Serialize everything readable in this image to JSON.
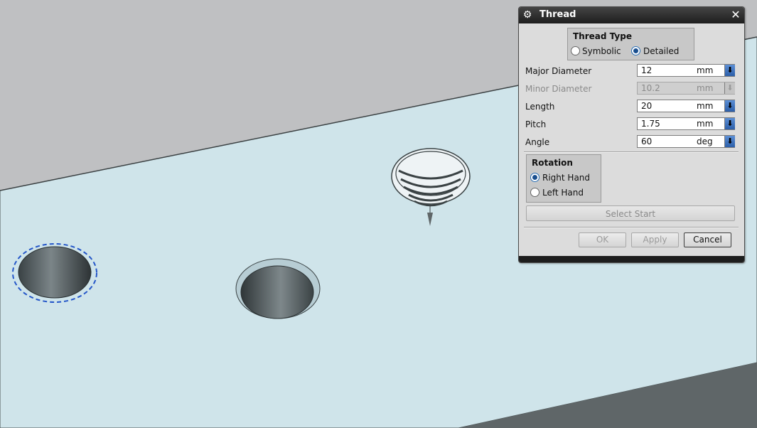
{
  "dialog": {
    "title": "Thread",
    "settings_icon": "gear-icon",
    "close_icon": "close-icon",
    "thread_type": {
      "title": "Thread Type",
      "options": [
        "Symbolic",
        "Detailed"
      ],
      "selected": "Detailed"
    },
    "rows": [
      {
        "label": "Major Diameter",
        "value": "12",
        "unit": "mm",
        "enabled": true
      },
      {
        "label": "Minor Diameter",
        "value": "10.2",
        "unit": "mm",
        "enabled": false
      },
      {
        "label": "Length",
        "value": "20",
        "unit": "mm",
        "enabled": true
      },
      {
        "label": "Pitch",
        "value": "1.75",
        "unit": "mm",
        "enabled": true
      },
      {
        "label": "Angle",
        "value": "60",
        "unit": "deg",
        "enabled": true
      }
    ],
    "rotation": {
      "title": "Rotation",
      "options": [
        "Right Hand",
        "Left Hand"
      ],
      "selected": "Right Hand"
    },
    "select_start": "Select Start",
    "ok": "OK",
    "apply": "Apply",
    "cancel": "Cancel"
  },
  "colors": {
    "face": "#cfe4ea",
    "wall": "#bfc0c2",
    "dark_surface": "#5f6668",
    "selection": "#2456c8"
  }
}
